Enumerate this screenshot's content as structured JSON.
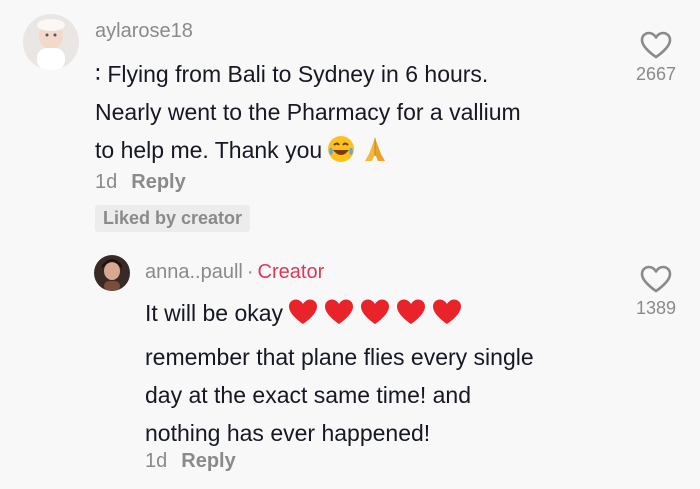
{
  "comment": {
    "username": "aylarose18",
    "lines": [
      "∶ Flying from Bali to Sydney in 6 hours.",
      "Nearly went to the Pharmacy for a vallium",
      "to help me. Thank you"
    ],
    "emojis": [
      "😂",
      "🙏"
    ],
    "time": "1d",
    "reply_label": "Reply",
    "liked_badge": "Liked by creator",
    "like_count": "2667"
  },
  "reply": {
    "username": "anna..paull",
    "separator": "·",
    "creator_label": "Creator",
    "lines": [
      "It will be okay",
      "remember that plane flies every single",
      "day at the exact same time! and",
      "nothing has ever happened!"
    ],
    "hearts": [
      "❤️",
      "❤️",
      "❤️",
      "❤️",
      "❤️"
    ],
    "time": "1d",
    "reply_label": "Reply",
    "like_count": "1389"
  },
  "colors": {
    "creator": "#e0365a",
    "muted": "#8a8a8a",
    "text": "#161823",
    "background": "#f8f8f8"
  }
}
